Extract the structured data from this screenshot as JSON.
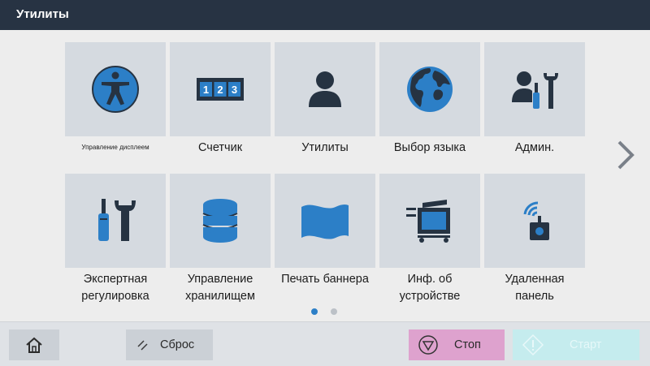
{
  "title": "Утилиты",
  "tiles": [
    {
      "label": "Управление дисплеем",
      "icon": "accessibility-icon"
    },
    {
      "label": "Счетчик",
      "icon": "counter-icon",
      "counter_digits": "1 2 3"
    },
    {
      "label": "Утилиты",
      "icon": "person-icon"
    },
    {
      "label": "Выбор языка",
      "icon": "globe-icon"
    },
    {
      "label": "Админ.",
      "icon": "admin-tools-icon"
    },
    {
      "label": "Экспертная регулировка",
      "icon": "screwdriver-wrench-icon"
    },
    {
      "label": "Управление хранилищем",
      "icon": "database-icon"
    },
    {
      "label": "Печать баннера",
      "icon": "banner-icon"
    },
    {
      "label": "Инф. об устройстве",
      "icon": "printer-icon"
    },
    {
      "label": "Удаленная панель",
      "icon": "remote-panel-icon"
    }
  ],
  "pagination": {
    "current": 1,
    "total": 2
  },
  "bottom": {
    "home_icon": "home-icon",
    "reset_label": "Сброс",
    "stop_label": "Стоп",
    "start_label": "Старт"
  },
  "colors": {
    "title_bar": "#273343",
    "tile_background": "#d5dae0",
    "accent_blue": "#2c7fc7",
    "icon_dark": "#263342",
    "stop_button": "#dea2ce",
    "start_button": "#c5ecee"
  }
}
